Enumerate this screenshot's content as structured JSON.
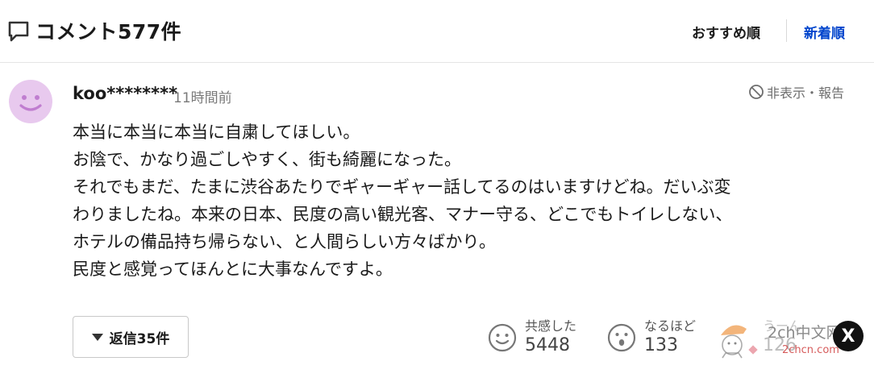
{
  "header": {
    "title": "コメント577件",
    "sort_recommended": "おすすめ順",
    "sort_newest": "新着順"
  },
  "comment": {
    "username": "koo********",
    "timestamp": "11時間前",
    "report_label": "非表示・報告",
    "lines": [
      "本当に本当に本当に自粛してほしい。",
      "お陰で、かなり過ごしやすく、街も綺麗になった。",
      "それでもまだ、たまに渋谷あたりでギャーギャー話してるのはいますけどね。だいぶ変",
      "わりましたね。本来の日本、民度の高い観光客、マナー守る、どこでもトイレしない、",
      "ホテルの備品持ち帰らない、と人間らしい方々ばかり。",
      "民度と感覚ってほんとに大事なんですよ。"
    ],
    "reply_label": "返信35件"
  },
  "reactions": [
    {
      "label": "共感した",
      "count": "5448",
      "icon": "smile-face-icon"
    },
    {
      "label": "なるほど",
      "count": "133",
      "icon": "surprised-face-icon"
    },
    {
      "label": "うーん",
      "count": "126",
      "icon": "hmm-face-icon"
    }
  ],
  "watermark": {
    "text": "2ch中文网",
    "sub": "2chcn.com",
    "x_label": "X"
  },
  "colors": {
    "accent": "#0044cc",
    "avatar_bg": "#e8c9ee",
    "avatar_face": "#c07ed0"
  }
}
